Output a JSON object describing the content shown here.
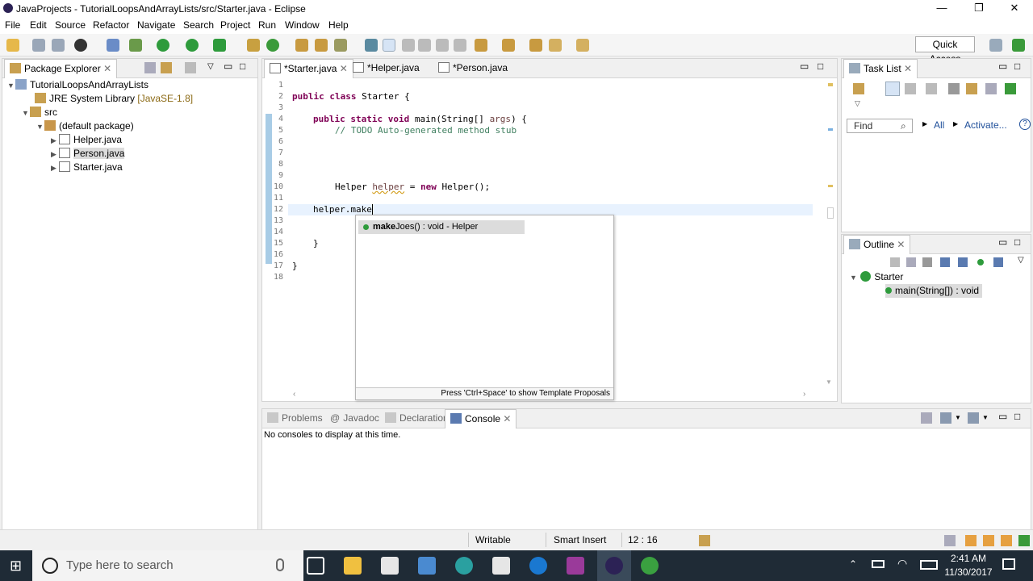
{
  "window": {
    "title": "JavaProjects - TutorialLoopsAndArrayLists/src/Starter.java - Eclipse"
  },
  "menu": [
    "File",
    "Edit",
    "Source",
    "Refactor",
    "Navigate",
    "Search",
    "Project",
    "Run",
    "Window",
    "Help"
  ],
  "toolbar": {
    "quick_access": "Quick Access"
  },
  "package_explorer": {
    "title": "Package Explorer",
    "rows": [
      {
        "label": "TutorialLoopsAndArrayLists",
        "extra": ""
      },
      {
        "label": "JRE System Library",
        "extra": "[JavaSE-1.8]"
      },
      {
        "label": "src",
        "extra": ""
      },
      {
        "label": "(default package)",
        "extra": ""
      },
      {
        "label": "Helper.java",
        "extra": ""
      },
      {
        "label": "Person.java",
        "extra": ""
      },
      {
        "label": "Starter.java",
        "extra": ""
      }
    ]
  },
  "editor": {
    "tabs": [
      "*Starter.java",
      "*Helper.java",
      "*Person.java"
    ],
    "line_numbers": [
      "1",
      "2",
      "3",
      "4",
      "5",
      "6",
      "7",
      "8",
      "9",
      "10",
      "11",
      "12",
      "13",
      "14",
      "15",
      "16",
      "17",
      "18"
    ],
    "lines": {
      "l2": [
        "public class",
        " Starter {"
      ],
      "l4": [
        "public static void",
        " main(String[] ",
        "args",
        ") {"
      ],
      "l5": "// TODO Auto-generated method stub",
      "l10": [
        "Helper ",
        "helper",
        " = ",
        "new",
        " Helper();"
      ],
      "l12": "helper.make",
      "l15": "}",
      "l17": "}"
    }
  },
  "autocomplete": {
    "match": "make",
    "rest": "Joes() : void - Helper",
    "footer": "Press 'Ctrl+Space' to show Template Proposals"
  },
  "task_list": {
    "title": "Task List",
    "find_placeholder": "Find",
    "all": "All",
    "activate": "Activate..."
  },
  "outline": {
    "title": "Outline",
    "class_name": "Starter",
    "method": "main(String[]) : void"
  },
  "bottom": {
    "tabs": [
      "Problems",
      "Javadoc",
      "Declaration",
      "Console"
    ],
    "console_message": "No consoles to display at this time."
  },
  "status": {
    "mode": "Writable",
    "insert": "Smart Insert",
    "position": "12 : 16"
  },
  "taskbar": {
    "search_placeholder": "Type here to search",
    "time": "2:41 AM",
    "date": "11/30/2017"
  },
  "colors": {
    "keyword": "#7f0055",
    "comment": "#3f7f5f",
    "taskbar": "#1f2b36"
  }
}
